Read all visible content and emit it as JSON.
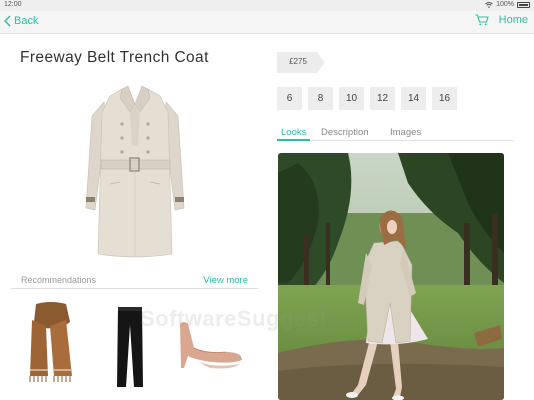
{
  "status_bar": {
    "time": "12:00",
    "battery": "100%"
  },
  "nav": {
    "back_label": "Back",
    "home_label": "Home"
  },
  "product": {
    "title": "Freeway Belt Trench Coat",
    "price": "£275",
    "sizes": [
      "6",
      "8",
      "10",
      "12",
      "14",
      "16"
    ]
  },
  "tabs": [
    {
      "label": "Looks",
      "active": true
    },
    {
      "label": "Description",
      "active": false
    },
    {
      "label": "Images",
      "active": false
    }
  ],
  "recommendations": {
    "label": "Recommendations",
    "view_more_label": "View more",
    "items": [
      "scarf",
      "trousers",
      "heels"
    ]
  },
  "watermark": "SoftwareSuggest",
  "colors": {
    "accent": "#2bbf9f",
    "coat": "#e3ddd2",
    "scarf": "#9a6536",
    "shoes": "#dcae9b"
  },
  "icons": [
    "chevron-left-icon",
    "cart-icon",
    "wifi-icon",
    "battery-icon"
  ]
}
